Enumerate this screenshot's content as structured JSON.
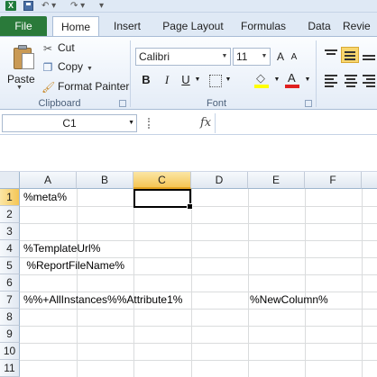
{
  "tabs": [
    "File",
    "Home",
    "Insert",
    "Page Layout",
    "Formulas",
    "Data",
    "Revie"
  ],
  "ribbon": {
    "clipboard": {
      "paste": "Paste",
      "cut": "Cut",
      "copy": "Copy",
      "format_painter": "Format Painter",
      "group_label": "Clipboard"
    },
    "font": {
      "name": "Calibri",
      "size": "11",
      "bold": "B",
      "italic": "I",
      "underline": "U",
      "group_label": "Font"
    }
  },
  "formula_bar": {
    "name_box": "C1",
    "fx": "fx",
    "formula": ""
  },
  "grid": {
    "columns": [
      "A",
      "B",
      "C",
      "D",
      "E",
      "F"
    ],
    "selected_column": "C",
    "rows": [
      "1",
      "2",
      "3",
      "4",
      "5",
      "6",
      "7",
      "8",
      "9",
      "10",
      "11"
    ],
    "selected_row": "1",
    "cells": {
      "A1": "%meta%",
      "A4": "%TemplateUrl%",
      "A5": " %ReportFileName%",
      "A7": "%%+AllInstances%%Attribute1%",
      "E7": "%NewColumn%"
    }
  },
  "colors": {
    "file_tab": "#2a7a3a",
    "selection_header": "#f5c655"
  }
}
